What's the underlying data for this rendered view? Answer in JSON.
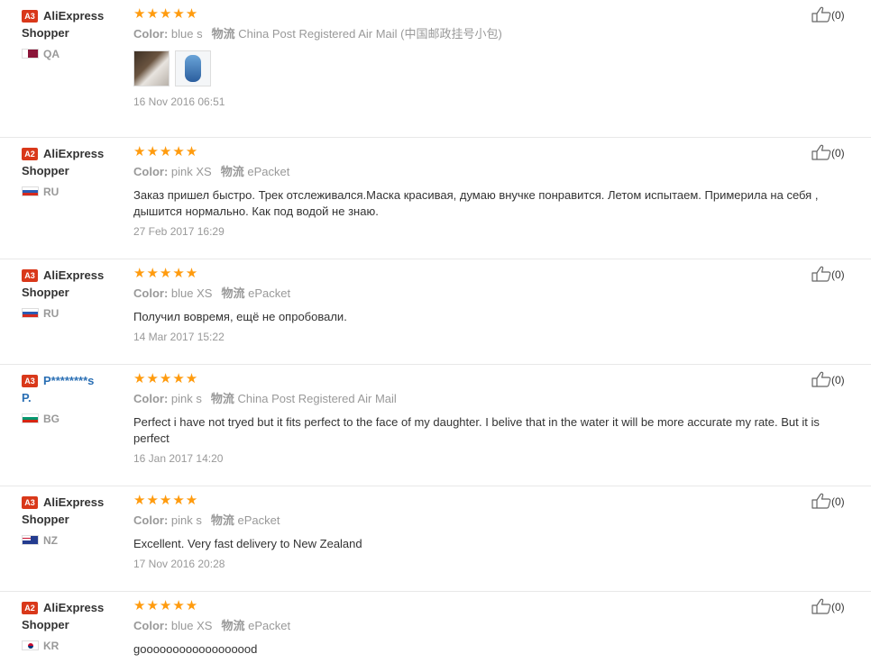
{
  "reviews": [
    {
      "badge": "A3",
      "user_line1": "AliExpress",
      "user_line2": "Shopper",
      "country": "QA",
      "color_label": "Color:",
      "color": "blue s",
      "ship_label": "物流",
      "shipping": "China Post Registered Air Mail (中国邮政挂号小包)",
      "text": "",
      "date": "16 Nov 2016 06:51",
      "likes": "(0)"
    },
    {
      "badge": "A2",
      "user_line1": "AliExpress",
      "user_line2": "Shopper",
      "country": "RU",
      "color_label": "Color:",
      "color": "pink XS",
      "ship_label": "物流",
      "shipping": "ePacket",
      "text": "Заказ пришел быстро. Трек отслеживался.Маска красивая, думаю внучке понравится. Летом испытаем. Примерила на себя , дышится нормально. Как под водой не знаю.",
      "date": "27 Feb 2017 16:29",
      "likes": "(0)"
    },
    {
      "badge": "A3",
      "user_line1": "AliExpress",
      "user_line2": "Shopper",
      "country": "RU",
      "color_label": "Color:",
      "color": "blue XS",
      "ship_label": "物流",
      "shipping": "ePacket",
      "text": "Получил вовремя, ещё не опробовали.",
      "date": "14 Mar 2017 15:22",
      "likes": "(0)"
    },
    {
      "badge": "A3",
      "user_line1": "P********s",
      "user_line2": "P.",
      "country": "BG",
      "color_label": "Color:",
      "color": "pink s",
      "ship_label": "物流",
      "shipping": "China Post Registered Air Mail",
      "text": "Perfect i have not tryed but it fits perfect to the face of my daughter. I belive that in the water it will be more accurate my rate. But it is perfect",
      "date": "16 Jan 2017 14:20",
      "likes": "(0)"
    },
    {
      "badge": "A3",
      "user_line1": "AliExpress",
      "user_line2": "Shopper",
      "country": "NZ",
      "color_label": "Color:",
      "color": "pink s",
      "ship_label": "物流",
      "shipping": "ePacket",
      "text": "Excellent. Very fast delivery to New Zealand",
      "date": "17 Nov 2016 20:28",
      "likes": "(0)"
    },
    {
      "badge": "A2",
      "user_line1": "AliExpress",
      "user_line2": "Shopper",
      "country": "KR",
      "color_label": "Color:",
      "color": "blue XS",
      "ship_label": "物流",
      "shipping": "ePacket",
      "text": "goooooooooooooooood",
      "date": "",
      "likes": "(0)"
    }
  ],
  "star_glyph": "★★★★★",
  "rating_stars": 5,
  "icons": {
    "like": "thumbs-up-icon",
    "flag": "flag-icon",
    "badge": "buyer-level-badge"
  },
  "colors": {
    "star": "#ff9b0e",
    "badge": "#d9381a",
    "masked_name": "#2a6fb4",
    "muted": "#999999"
  }
}
